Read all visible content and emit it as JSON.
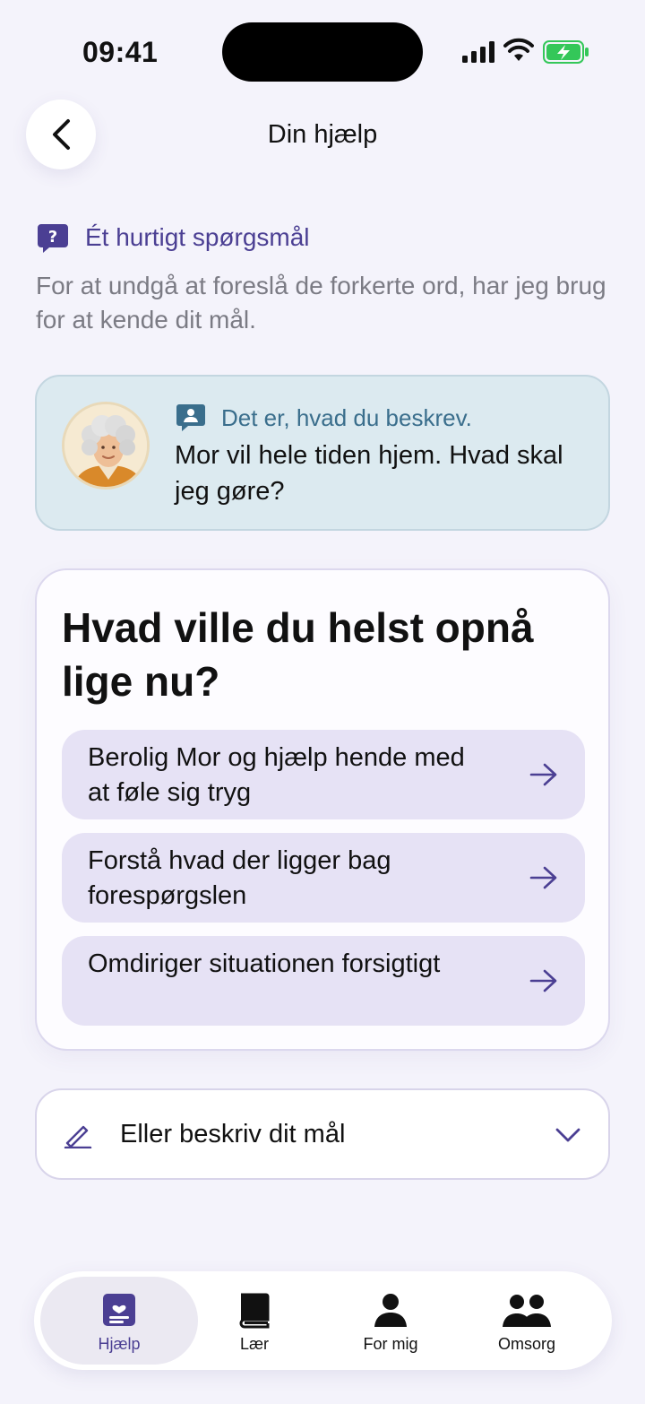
{
  "status_bar": {
    "time": "09:41"
  },
  "header": {
    "title": "Din hjælp"
  },
  "question": {
    "heading": "Ét hurtigt spørgsmål",
    "body": "For at undgå at foreslå de forkerte ord, har jeg brug for at kende dit mål."
  },
  "described": {
    "label": "Det er, hvad du beskrev.",
    "text": "Mor vil hele tiden hjem. Hvad skal jeg gøre?"
  },
  "goal": {
    "title": "Hvad ville du helst opnå lige nu?",
    "options": [
      {
        "label": "Berolig Mor og hjælp hende med at føle sig tryg"
      },
      {
        "label": "Forstå hvad der ligger bag forespørgslen"
      },
      {
        "label": "Omdiriger situationen forsigtigt"
      }
    ]
  },
  "describe_goal": {
    "label": "Eller beskriv dit mål"
  },
  "tabs": [
    {
      "label": "Hjælp",
      "icon": "help-card-icon",
      "active": true
    },
    {
      "label": "Lær",
      "icon": "book-icon",
      "active": false
    },
    {
      "label": "For mig",
      "icon": "person-icon",
      "active": false
    },
    {
      "label": "Omsorg",
      "icon": "people-icon",
      "active": false
    }
  ],
  "colors": {
    "accent": "#4b3f93",
    "background": "#f4f3fb",
    "option_bg": "#e6e2f5",
    "described_bg": "#dceaf0",
    "battery": "#34c759"
  }
}
